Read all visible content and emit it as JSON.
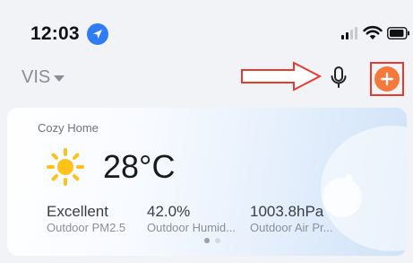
{
  "status_bar": {
    "time": "12:03",
    "signal_level": "2 of 4 bars"
  },
  "header": {
    "home_name": "VIS"
  },
  "weather_card": {
    "title": "Cozy Home",
    "temperature": "28°C",
    "stats": [
      {
        "value": "Excellent",
        "label": "Outdoor PM2.5"
      },
      {
        "value": "42.0%",
        "label": "Outdoor Humid..."
      },
      {
        "value": "1003.8hPa",
        "label": "Outdoor Air Pr..."
      }
    ],
    "page_indicator": {
      "current": 1,
      "total": 2
    }
  },
  "colors": {
    "accent_orange": "#f5793b",
    "annotation_red": "#e83a2f",
    "location_blue": "#2f7cf6",
    "sun_yellow": "#ffc21a"
  },
  "icons": [
    "location-arrow-icon",
    "signal-icon",
    "wifi-icon",
    "battery-icon",
    "dropdown-caret-icon",
    "annotation-arrow-icon",
    "microphone-icon",
    "plus-icon",
    "sun-icon"
  ]
}
